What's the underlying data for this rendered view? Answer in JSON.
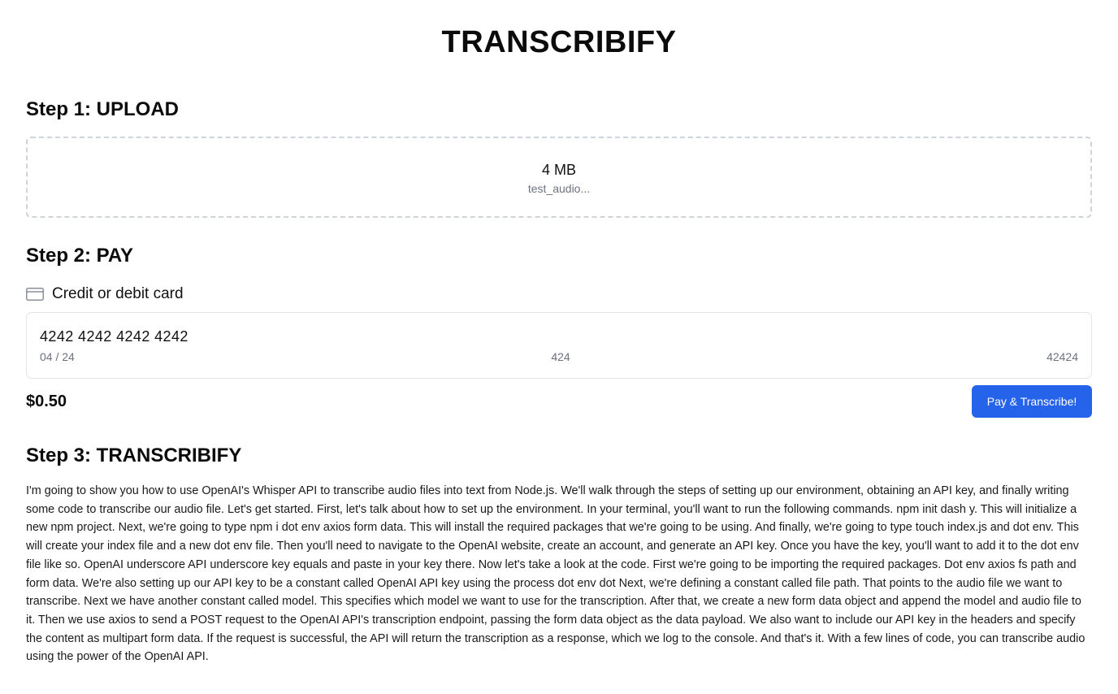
{
  "app": {
    "title": "TRANSCRIBIFY"
  },
  "step1": {
    "heading": "Step 1: UPLOAD",
    "file_size": "4 MB",
    "file_name": "test_audio..."
  },
  "step2": {
    "heading": "Step 2: PAY",
    "payment_method_label": "Credit or debit card",
    "payment_method_icon": "credit-card-icon",
    "card_number": "4242 4242 4242 4242",
    "expiry": "04 / 24",
    "cvc": "424",
    "zip": "42424",
    "price": "$0.50",
    "pay_button_label": "Pay & Transcribe!",
    "accent_color": "#2563eb"
  },
  "step3": {
    "heading": "Step 3: TRANSCRIBIFY",
    "transcript": "I'm going to show you how to use OpenAI's Whisper API to transcribe audio files into text from Node.js. We'll walk through the steps of setting up our environment, obtaining an API key, and finally writing some code to transcribe our audio file. Let's get started. First, let's talk about how to set up the environment. In your terminal, you'll want to run the following commands. npm init dash y. This will initialize a new npm project. Next, we're going to type npm i dot env axios form data. This will install the required packages that we're going to be using. And finally, we're going to type touch index.js and dot env. This will create your index file and a new dot env file. Then you'll need to navigate to the OpenAI website, create an account, and generate an API key. Once you have the key, you'll want to add it to the dot env file like so. OpenAI underscore API underscore key equals and paste in your key there. Now let's take a look at the code. First we're going to be importing the required packages. Dot env axios fs path and form data. We're also setting up our API key to be a constant called OpenAI API key using the process dot env dot Next, we're defining a constant called file path. That points to the audio file we want to transcribe. Next we have another constant called model. This specifies which model we want to use for the transcription. After that, we create a new form data object and append the model and audio file to it. Then we use axios to send a POST request to the OpenAI API's transcription endpoint, passing the form data object as the data payload. We also want to include our API key in the headers and specify the content as multipart form data. If the request is successful, the API will return the transcription as a response, which we log to the console. And that's it. With a few lines of code, you can transcribe audio using the power of the OpenAI API."
  }
}
